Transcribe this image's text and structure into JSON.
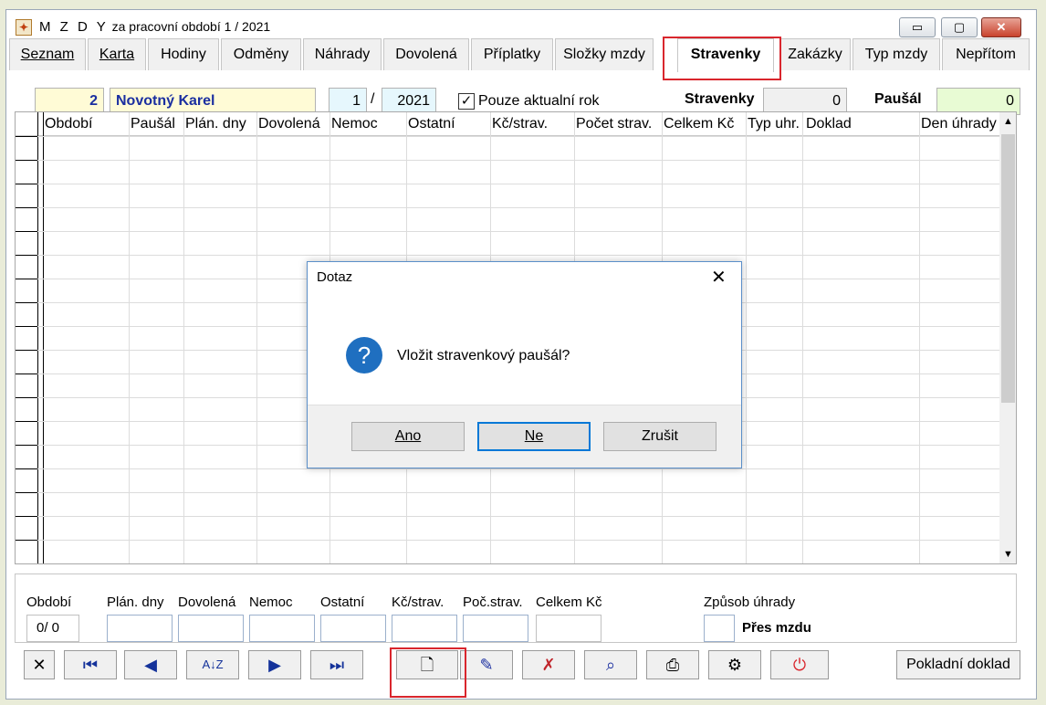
{
  "window": {
    "title_prefix": "M Z D Y",
    "title_rest": "za pracovní období  1 / 2021",
    "app_icon": "app-icon",
    "min": "▭",
    "max": "▢",
    "close": "✕"
  },
  "tabs": [
    {
      "label": "Seznam"
    },
    {
      "label": "Karta"
    },
    {
      "label": "Hodiny"
    },
    {
      "label": "Odměny"
    },
    {
      "label": "Náhrady"
    },
    {
      "label": "Dovolená"
    },
    {
      "label": "Příplatky"
    },
    {
      "label": "Složky mzdy"
    },
    {
      "label": "Stravenky"
    },
    {
      "label": "Zakázky"
    },
    {
      "label": "Typ mzdy"
    },
    {
      "label": "Nepřítom"
    }
  ],
  "header": {
    "employee_number": "2",
    "employee_name": "Novotný Karel",
    "period_month": "1",
    "period_separator": "/",
    "period_year": "2021",
    "checkbox_label": "Pouze aktualní rok",
    "checkbox_checked": true,
    "stravenky_label": "Stravenky",
    "stravenky_value": "0",
    "pausal_label": "Paušál",
    "pausal_value": "0"
  },
  "grid": {
    "columns": [
      "Období",
      "Paušál",
      "Plán. dny",
      "Dovolená",
      "Nemoc",
      "Ostatní",
      "Kč/strav.",
      "Počet strav.",
      "Celkem Kč",
      "Typ uhr.",
      "Doklad",
      "Den úhrady"
    ],
    "scroll_up": "▲",
    "scroll_down": "▼"
  },
  "dialog": {
    "title": "Dotaz",
    "close": "✕",
    "icon": "question-icon",
    "icon_glyph": "?",
    "message": "Vložit stravenkový paušál?",
    "buttons": {
      "yes": "Ano",
      "no": "Ne",
      "cancel": "Zrušit"
    }
  },
  "detail": {
    "labels": [
      "Období",
      "Plán. dny",
      "Dovolená",
      "Nemoc",
      "Ostatní",
      "Kč/strav.",
      "Poč.strav.",
      "Celkem Kč"
    ],
    "obdobi_value": "0/  0",
    "zpusob_label": "Způsob úhrady",
    "zpusob_value": "Přes mzdu"
  },
  "toolbar": {
    "buttons": [
      {
        "name": "cancel-tool",
        "glyph": "✕"
      },
      {
        "name": "first-record",
        "glyph": "⏮"
      },
      {
        "name": "prev-record",
        "glyph": "◀"
      },
      {
        "name": "sort",
        "glyph": "A↓Z"
      },
      {
        "name": "next-record",
        "glyph": "▶"
      },
      {
        "name": "last-record",
        "glyph": "⏭"
      },
      {
        "name": "new-record",
        "glyph": "🗋"
      },
      {
        "name": "edit-record",
        "glyph": "✎"
      },
      {
        "name": "delete-record",
        "glyph": "✗"
      },
      {
        "name": "find",
        "glyph": "⌕"
      },
      {
        "name": "print",
        "glyph": "⎙"
      },
      {
        "name": "tools",
        "glyph": "⚙"
      },
      {
        "name": "power",
        "glyph": "⏻"
      }
    ],
    "pokladni_doklad": "Pokladní doklad"
  },
  "colors": {
    "highlight_red": "#d9262d",
    "yellow_field": "#fffbd6",
    "cyan_field": "#e6f7fd",
    "green_field": "#e8fbd4",
    "name_blue": "#1b2fa0",
    "dialog_blue": "#1f6fc0"
  }
}
